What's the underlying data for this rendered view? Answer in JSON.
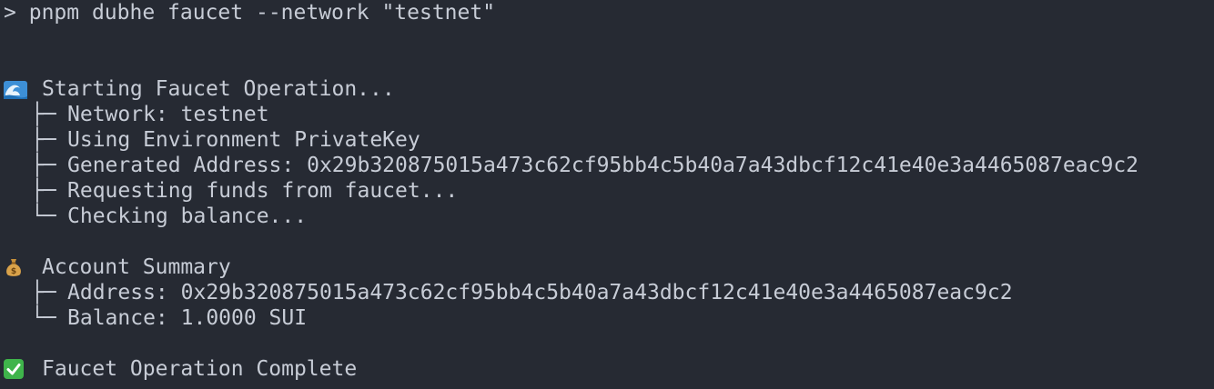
{
  "command": {
    "prompt": ">",
    "text": "pnpm dubhe faucet --network \"testnet\""
  },
  "faucet": {
    "header_icon": "water-wave-icon",
    "header": "Starting Faucet Operation...",
    "steps": [
      {
        "prefix": "├─",
        "text": "Network: testnet"
      },
      {
        "prefix": "├─",
        "text": "Using Environment PrivateKey"
      },
      {
        "prefix": "├─",
        "text": "Generated Address: 0x29b320875015a473c62cf95bb4c5b40a7a43dbcf12c41e40e3a4465087eac9c2"
      },
      {
        "prefix": "├─",
        "text": "Requesting funds from faucet..."
      },
      {
        "prefix": "└─",
        "text": "Checking balance..."
      }
    ]
  },
  "summary": {
    "header_icon": "money-bag-icon",
    "header": "Account Summary",
    "items": [
      {
        "prefix": "├─",
        "text": "Address: 0x29b320875015a473c62cf95bb4c5b40a7a43dbcf12c41e40e3a4465087eac9c2"
      },
      {
        "prefix": "└─",
        "text": "Balance: 1.0000 SUI"
      }
    ]
  },
  "complete": {
    "icon": "check-mark-icon",
    "text": "Faucet Operation Complete"
  },
  "colors": {
    "background": "#262a33",
    "text": "#c7ccd6",
    "check": "#3fb44b"
  }
}
